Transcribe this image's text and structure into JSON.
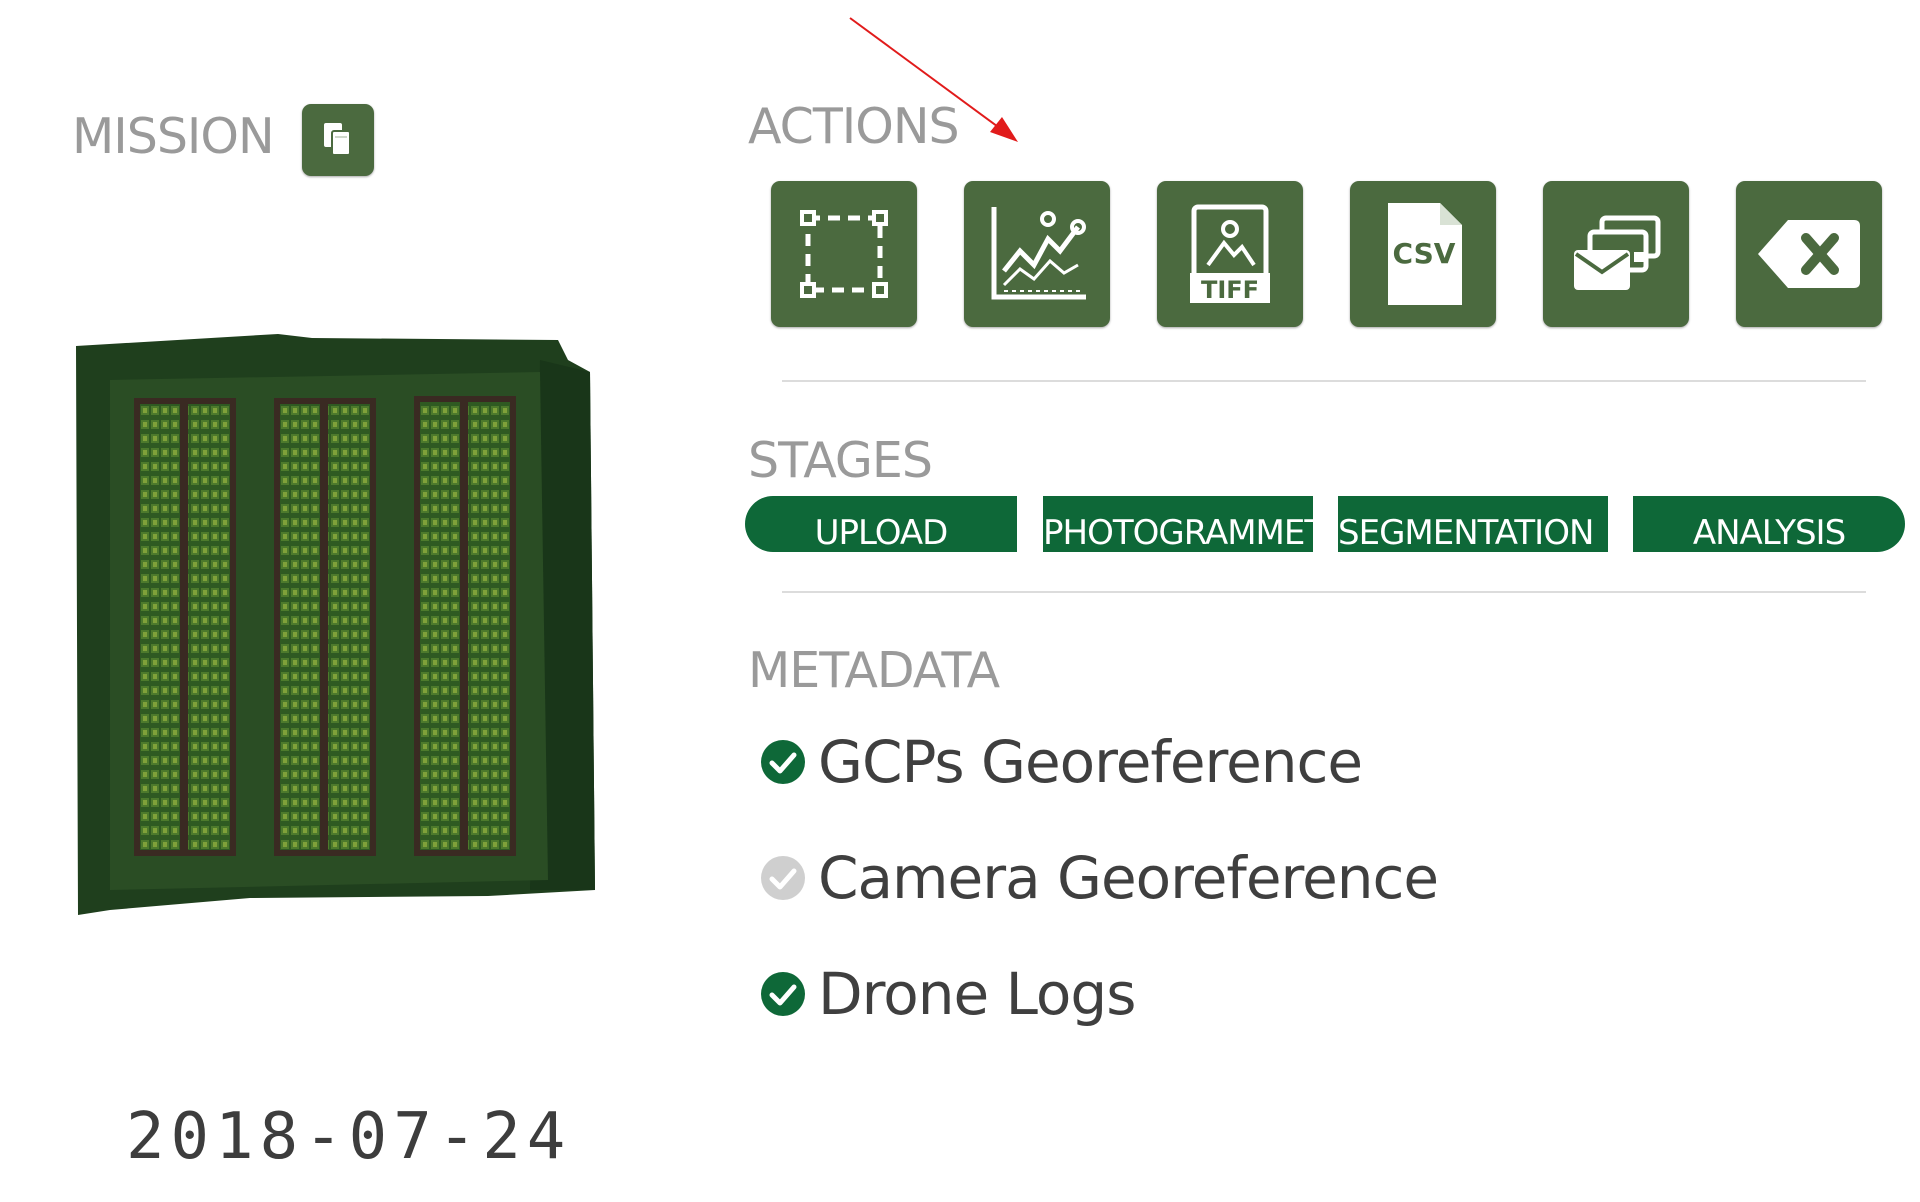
{
  "mission": {
    "label": "MISSION",
    "date": "2018-07-24"
  },
  "actions": {
    "label": "ACTIONS",
    "buttons": [
      {
        "icon": "select-region-icon"
      },
      {
        "icon": "chart-analysis-icon"
      },
      {
        "icon": "tiff-image-icon",
        "text": "TIFF"
      },
      {
        "icon": "csv-file-icon",
        "text": "CSV"
      },
      {
        "icon": "envelopes-share-icon"
      },
      {
        "icon": "delete-backspace-icon"
      }
    ]
  },
  "stages": {
    "label": "STAGES",
    "items": [
      "UPLOAD",
      "PHOTOGRAMMETRY",
      "SEGMENTATION",
      "ANALYSIS"
    ]
  },
  "metadata": {
    "label": "METADATA",
    "items": [
      {
        "text": "GCPs Georeference",
        "status": "complete"
      },
      {
        "text": "Camera Georeference",
        "status": "incomplete"
      },
      {
        "text": "Drone Logs",
        "status": "complete"
      }
    ]
  },
  "colors": {
    "button_bg": "#4b6a3f",
    "stage_bg": "#0e6838",
    "check_complete": "#0e6838",
    "check_incomplete": "#cfcfcf",
    "label_gray": "#9a9a9a",
    "annotation_arrow": "#e11b1b"
  }
}
